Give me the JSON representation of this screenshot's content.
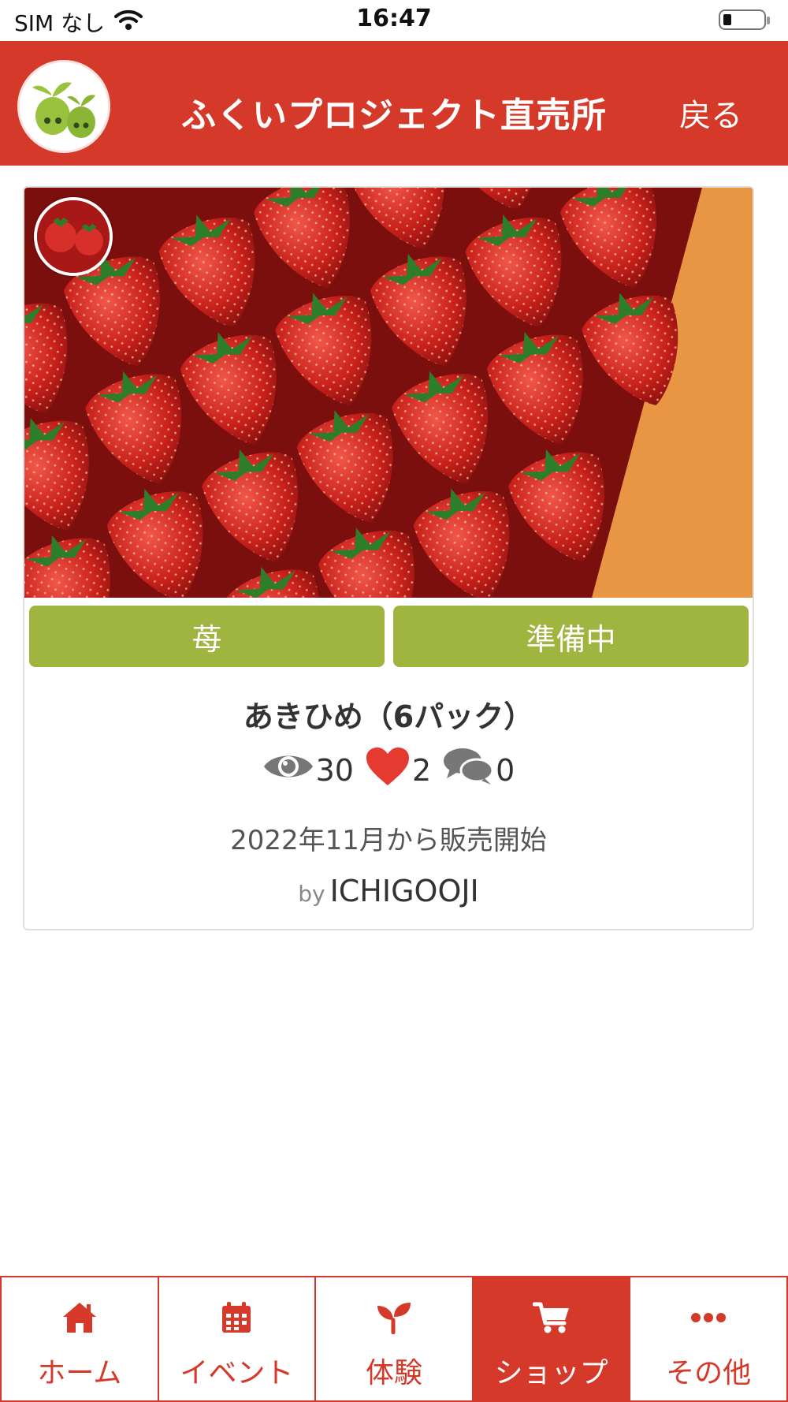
{
  "status_bar": {
    "carrier": "SIM なし",
    "time": "16:47"
  },
  "header": {
    "title": "ふくいプロジェクト直売所",
    "back_label": "戻る"
  },
  "product": {
    "category": "苺",
    "status": "準備中",
    "name": "あきひめ（6パック）",
    "views": "30",
    "likes": "2",
    "comments": "0",
    "sale_start": "2022年11月から販売開始",
    "by_label": "by",
    "seller": "ICHIGOOJI"
  },
  "nav": {
    "items": [
      {
        "label": "ホーム",
        "icon": "home-icon"
      },
      {
        "label": "イベント",
        "icon": "calendar-icon"
      },
      {
        "label": "体験",
        "icon": "sprout-icon"
      },
      {
        "label": "ショップ",
        "icon": "cart-icon",
        "active": true
      },
      {
        "label": "その他",
        "icon": "more-icon"
      }
    ]
  },
  "colors": {
    "brand": "#d5392a",
    "tag_green": "#9fb53f",
    "heart": "#e53a2f",
    "icon_gray": "#777777"
  }
}
